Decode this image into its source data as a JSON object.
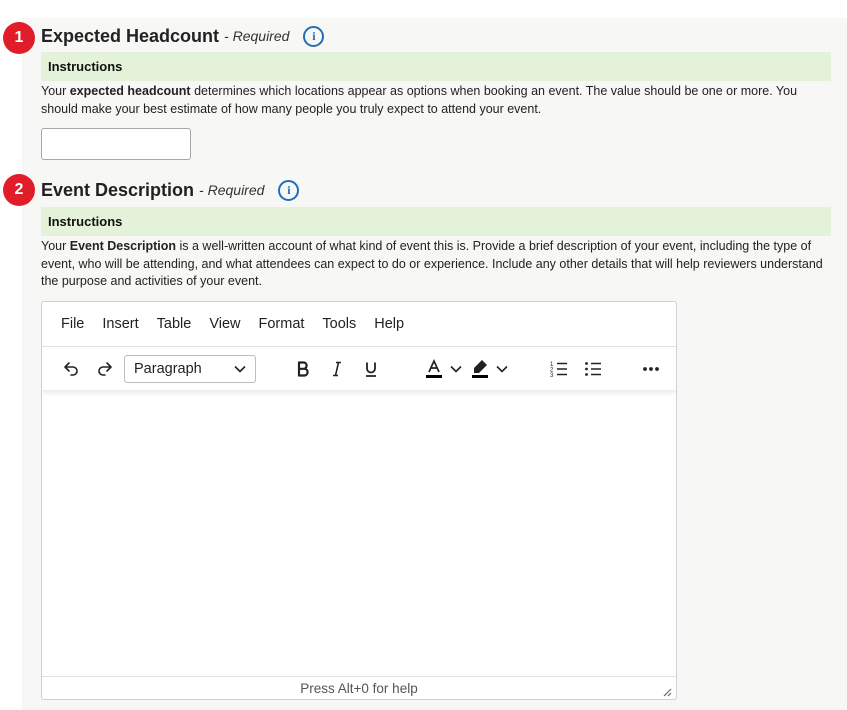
{
  "headcount": {
    "step": "1",
    "title": "Expected Headcount",
    "required": "- Required",
    "info_glyph": "i",
    "instructions_label": "Instructions",
    "text_prefix": "Your ",
    "text_bold": "expected headcount",
    "text_suffix": " determines which locations appear as options when booking an event.  The value should be one or more.  You should make your best estimate of how many people you truly expect to attend your event.",
    "input_value": ""
  },
  "description": {
    "step": "2",
    "title": "Event Description",
    "required": "- Required",
    "info_glyph": "i",
    "instructions_label": "Instructions",
    "text_prefix": "Your ",
    "text_bold": "Event Description",
    "text_suffix": " is a well-written account of what kind of event this is.  Provide a brief description of your event, including the type of event, who will be attending, and what attendees can expect to do or experience. Include any other details that will help reviewers understand the purpose and activities of your event."
  },
  "editor": {
    "menu": [
      "File",
      "Insert",
      "Table",
      "View",
      "Format",
      "Tools",
      "Help"
    ],
    "block_format": "Paragraph",
    "status_text": "Press Alt+0 for help",
    "text_color": "#000000",
    "highlight_color": "#000000",
    "toolbar_icons": [
      "undo-icon",
      "redo-icon",
      "bold-icon",
      "italic-icon",
      "underline-icon",
      "text-color-icon",
      "highlight-icon",
      "numbered-list-icon",
      "bullet-list-icon",
      "more-icon"
    ]
  },
  "colors": {
    "badge": "#e11d2a",
    "info": "#1f6fb5",
    "instructions_bg": "#e3f2d9"
  }
}
